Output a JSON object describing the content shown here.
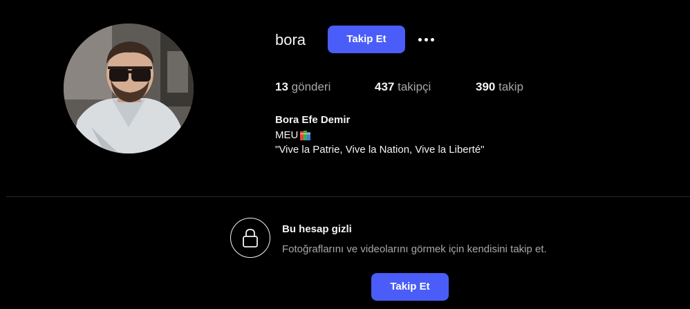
{
  "profile": {
    "username": "bora",
    "follow_label": "Takip Et",
    "more_icon": "more-horizontal-icon",
    "avatar_alt": "profile-photo"
  },
  "stats": {
    "posts_count": "13",
    "posts_label": "gönderi",
    "followers_count": "437",
    "followers_label": "takipçi",
    "following_count": "390",
    "following_label": "takip"
  },
  "bio": {
    "full_name": "Bora Efe Demir",
    "line1_text": "MEU",
    "line1_emoji_icon": "books-emoji-icon",
    "line2_text": "\"Vive la Patrie, Vive la Nation, Vive la Liberté\""
  },
  "private_notice": {
    "icon": "lock-icon",
    "title": "Bu hesap gizli",
    "description": "Fotoğraflarını ve videolarını görmek için kendisini takip et.",
    "follow_label": "Takip Et"
  },
  "colors": {
    "background": "#000000",
    "primary_button": "#4a5df9",
    "text_primary": "#f5f5f5",
    "text_secondary": "#a8a8a8",
    "divider": "#262626"
  }
}
